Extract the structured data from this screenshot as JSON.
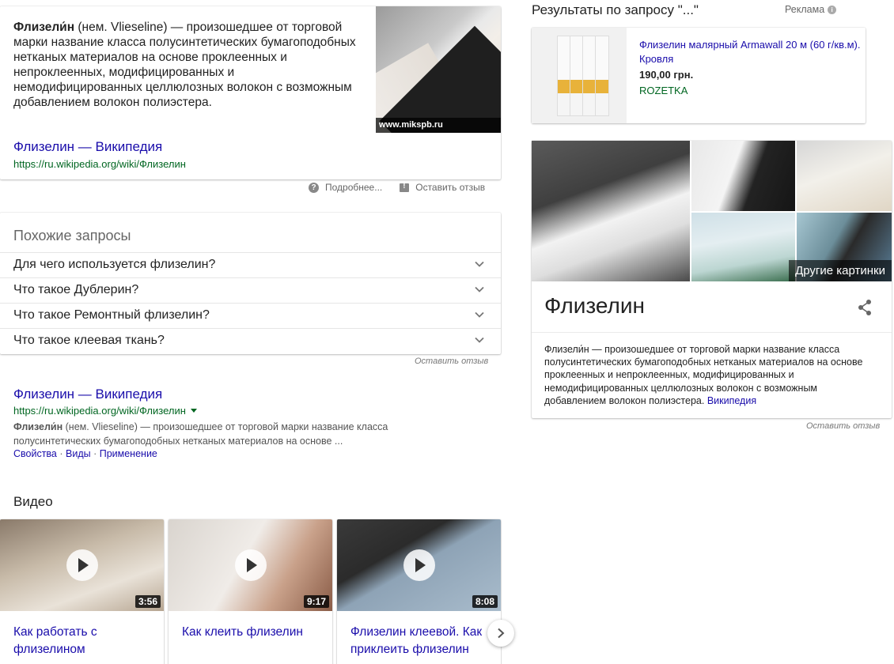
{
  "snippet": {
    "term": "Флизели́н",
    "text": " (нем. Vlieseline) — произошедшее от торговой марки название класса полусинтетических бумагоподобных нетканых материалов на основе проклеенных и непроклеенных, модифицированных и немодифицированных целлюлозных волокон с возможным добавлением волокон полиэстера.",
    "image_caption": "www.mikspb.ru",
    "source_title": "Флизелин — Википедия",
    "source_url": "https://ru.wikipedia.org/wiki/Флизелин"
  },
  "feedback": {
    "more": "Подробнее...",
    "leave": "Оставить отзыв",
    "small": "Оставить отзыв"
  },
  "related": {
    "heading": "Похожие запросы",
    "questions": [
      "Для чего используется флизелин?",
      "Что такое Дублерин?",
      "Что такое Ремонтный флизелин?",
      "Что такое клеевая ткань?"
    ]
  },
  "organic": {
    "title": "Флизелин — Википедия",
    "url": "https://ru.wikipedia.org/wiki/Флизелин",
    "term": "Флизели́н",
    "desc": " (нем. Vlieseline) — произошедшее от торговой марки название класса полусинтетических бумагоподобных нетканых материалов на основе ...",
    "links": [
      "Свойства",
      "Виды",
      "Применение"
    ]
  },
  "videos": {
    "heading": "Видео",
    "items": [
      {
        "title": "Как работать с флизелином",
        "duration": "3:56"
      },
      {
        "title": "Как клеить флизелин",
        "duration": "9:17"
      },
      {
        "title": "Флизелин клеевой. Как приклеить флизелин",
        "duration": "8:08"
      }
    ]
  },
  "ads": {
    "heading": "Результаты по запросу \"...\"",
    "label": "Реклама",
    "product": {
      "title": "Флизелин малярный Armawall 20 м (60 г/кв.м). Кровля",
      "price": "190,00 грн.",
      "store": "ROZETKA"
    }
  },
  "knowledge": {
    "more_images": "Другие картинки",
    "name": "Флизелин",
    "desc": "Флизели́н — произошедшее от торговой марки название класса полусинтетических бумагоподобных нетканых материалов на основе проклеенных и непроклеенных, модифицированных и немодифицированных целлюлозных волокон с возможным добавлением волокон полиэстера.",
    "source": "Википедия"
  },
  "colors": {
    "link": "#1a0dab",
    "url_green": "#006621",
    "text": "#222222",
    "muted": "#666666"
  }
}
